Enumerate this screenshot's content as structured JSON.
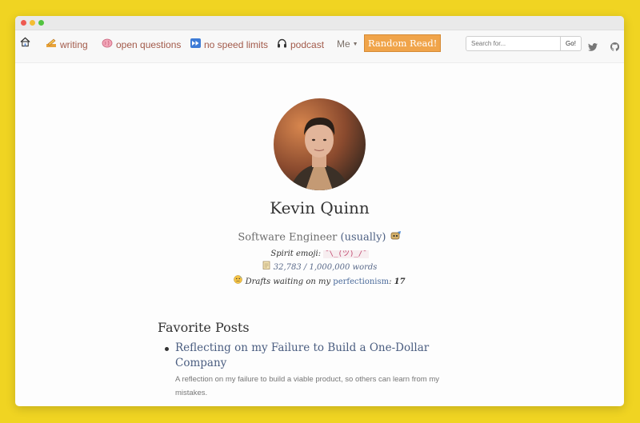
{
  "nav": {
    "home_icon": "house-icon",
    "items": [
      {
        "label": "writing",
        "icon": "pencil-icon"
      },
      {
        "label": "open questions",
        "icon": "brain-icon"
      },
      {
        "label": "no speed limits",
        "icon": "fast-forward-icon"
      },
      {
        "label": "podcast",
        "icon": "headphones-icon"
      },
      {
        "label": "Me",
        "icon": "caret-down-icon"
      }
    ],
    "random_button": "Random Read!",
    "search_placeholder": "Search for...",
    "search_button": "Go!",
    "accent_color": "#a25a4a",
    "button_color": "#f0a44a"
  },
  "profile": {
    "name": "Kevin Quinn",
    "title": "Software Engineer",
    "title_suffix": "(usually)",
    "spirit_label": "Spirit emoji:",
    "spirit_emoji": "¯\\_(ツ)_/¯",
    "word_count": "32,783 / 1,000,000 words",
    "drafts_prefix": "Drafts waiting on my",
    "drafts_link": "perfectionism",
    "drafts_count": "17"
  },
  "favorites": {
    "heading": "Favorite Posts",
    "posts": [
      {
        "title": "Reflecting on my Failure to Build a One-Dollar Company",
        "description": "A reflection on my failure to build a viable product, so others can learn from my mistakes."
      }
    ]
  },
  "page_background": "#f0d422"
}
